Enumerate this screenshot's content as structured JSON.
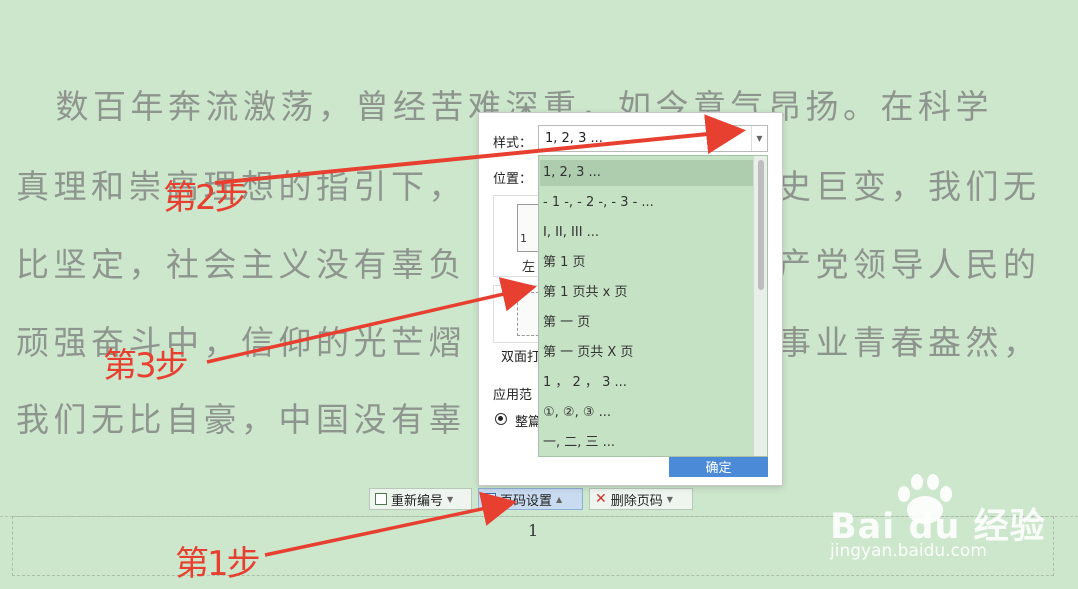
{
  "document": {
    "lines": [
      "　数百年奔流激荡，曾经苦难深重，如今意气昂扬。在科学",
      "真理和崇高理想的指引下，",
      "比坚定，社会主义没有辜负",
      "顽强奋斗中，信仰的光芒熠",
      "我们无比自豪，中国没有辜"
    ],
    "right_fragments": [
      "史巨变，我们无",
      "产党领导人民的",
      "事业青春盎然，"
    ],
    "page_number": "1"
  },
  "toolbar": {
    "renumber_label": "重新编号",
    "page_setup_label": "页码设置",
    "delete_label": "删除页码"
  },
  "dialog": {
    "style_label": "样式：",
    "style_value": "1, 2, 3 ...",
    "position_label": "位置：",
    "preview_number": "1",
    "preview_caption_left": "左",
    "duplex_label": "双面打",
    "apply_label": "应用范",
    "radio_label": "整篇",
    "ok_label": "确定",
    "dropdown_items": [
      "1, 2, 3 ...",
      "- 1 -, - 2 -, - 3 - ...",
      "I, II, III ...",
      "第 1 页",
      "第 1 页共 x 页",
      "第 一 页",
      "第 一 页共 X 页",
      "1 ， 2 ， 3 ...",
      "①, ②, ③ ...",
      "一, 二, 三 ..."
    ]
  },
  "annotations": {
    "step1": "第1步",
    "step2": "第2步",
    "step3": "第3步",
    "color": "#e84030"
  },
  "watermark": {
    "brand": "Bai du 经验",
    "url": "jingyan.baidu.com"
  },
  "colors": {
    "background": "#cde7cd",
    "dropdown_bg": "#c5e2c5",
    "ok_button": "#4a8ad6"
  }
}
